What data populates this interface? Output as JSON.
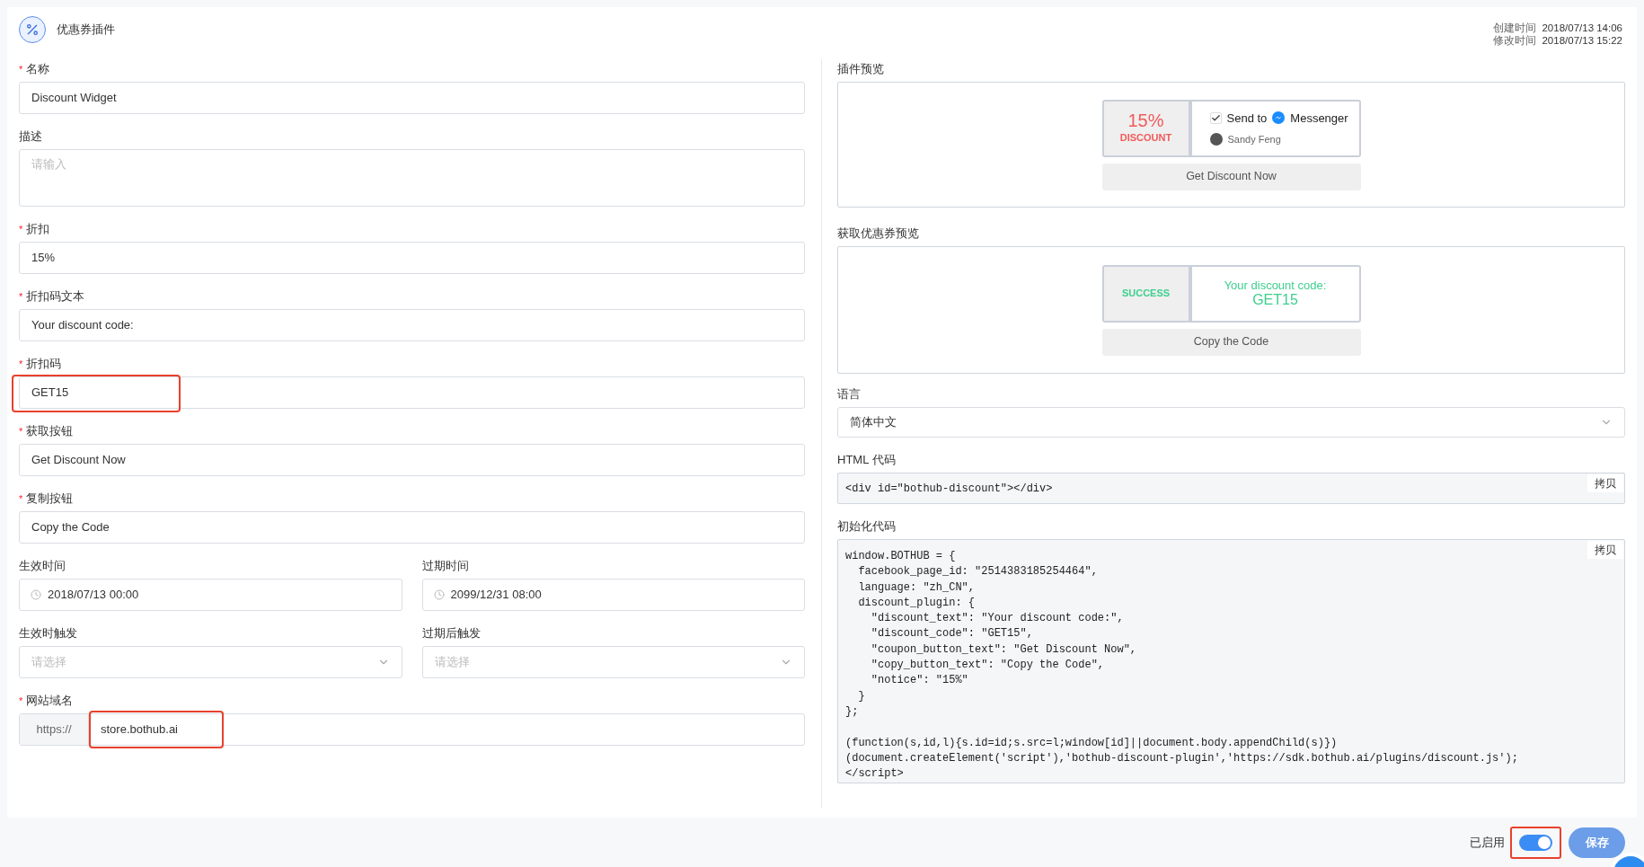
{
  "header": {
    "title": "优惠券插件",
    "created_label": "创建时间",
    "created": "2018/07/13 14:06",
    "modified_label": "修改时间",
    "modified": "2018/07/13 15:22"
  },
  "fields": [
    {
      "kind": "input",
      "label": "名称",
      "mark": "*",
      "value": "Discount Widget",
      "highlighted": false
    },
    {
      "kind": "textarea",
      "label": "描述",
      "placeholder": "请输入"
    },
    {
      "kind": "input",
      "label": "折扣",
      "mark": "*",
      "value": "15%",
      "highlighted": false
    },
    {
      "kind": "input",
      "label": "折扣码文本",
      "mark": "*",
      "value": "Your discount code:",
      "highlighted": false
    },
    {
      "kind": "input",
      "label": "折扣码",
      "mark": "*",
      "value": "GET15",
      "highlighted": true
    },
    {
      "kind": "input",
      "label": "获取按钮",
      "mark": "*",
      "value": "Get Discount Now",
      "highlighted": false
    },
    {
      "kind": "input",
      "label": "复制按钮",
      "mark": "*",
      "value": "Copy the Code",
      "highlighted": false
    },
    {
      "kind": "pair",
      "items": [
        {
          "kind": "date",
          "label": "生效时间",
          "value": "2018/07/13 00:00"
        },
        {
          "kind": "date",
          "label": "过期时间",
          "value": "2099/12/31 08:00"
        }
      ]
    },
    {
      "kind": "pair",
      "items": [
        {
          "kind": "select",
          "label": "生效时触发",
          "placeholder": "请选择"
        },
        {
          "kind": "select",
          "label": "过期后触发",
          "placeholder": "请选择"
        }
      ]
    },
    {
      "kind": "url",
      "label": "网站域名",
      "mark": "*",
      "prefix": "https://",
      "value": "store.bothub.ai",
      "highlighted": true
    }
  ],
  "preview": {
    "label": "插件预览",
    "percent": "15%",
    "discount": "DISCOUNT",
    "checked": true,
    "send_to": "Send to",
    "messenger": "Messenger",
    "user": "Sandy Feng",
    "button": "Get Discount Now"
  },
  "success_preview": {
    "label": "获取优惠券预览",
    "status": "SUCCESS",
    "code_text": "Your discount code:",
    "code": "GET15",
    "button": "Copy the Code"
  },
  "language": {
    "label": "语言",
    "value": "简体中文"
  },
  "html_code": {
    "label": "HTML 代码",
    "code": "<div id=\"bothub-discount\"></div>",
    "copy": "拷贝"
  },
  "init_code": {
    "label": "初始化代码",
    "code": "window.BOTHUB = {\n  facebook_page_id: \"2514383185254464\",\n  language: \"zh_CN\",\n  discount_plugin: {\n    \"discount_text\": \"Your discount code:\",\n    \"discount_code\": \"GET15\",\n    \"coupon_button_text\": \"Get Discount Now\",\n    \"copy_button_text\": \"Copy the Code\",\n    \"notice\": \"15%\"\n  }\n};\n\n(function(s,id,l){s.id=id;s.src=l;window[id]||document.body.appendChild(s)})\n(document.createElement('script'),'bothub-discount-plugin','https://sdk.bothub.ai/plugins/discount.js');\n</script>",
    "copy": "拷贝"
  },
  "footer": {
    "enabled_label": "已启用",
    "on": true,
    "toggle_highlighted": true,
    "save": "保存"
  }
}
